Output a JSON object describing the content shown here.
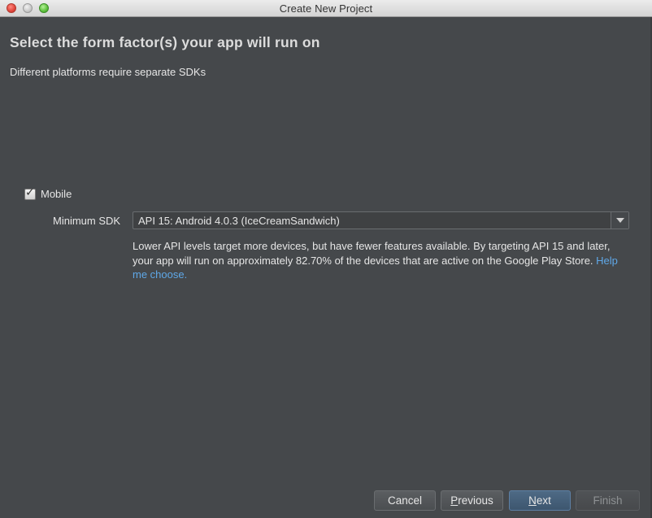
{
  "window": {
    "title": "Create New Project"
  },
  "page": {
    "heading": "Select the form factor(s) your app will run on",
    "subheading": "Different platforms require separate SDKs"
  },
  "mobile": {
    "checkbox_label": "Mobile",
    "checked": true,
    "min_sdk_label": "Minimum SDK",
    "min_sdk_value": "API 15: Android 4.0.3 (IceCreamSandwich)",
    "info_text": "Lower API levels target more devices, but have fewer features available. By targeting API 15 and later, your app will run on approximately 82.70% of the devices that are active on the Google Play Store. ",
    "help_link": "Help me choose."
  },
  "buttons": {
    "cancel": "Cancel",
    "previous_mnemonic": "P",
    "previous_rest": "revious",
    "next_mnemonic": "N",
    "next_rest": "ext",
    "finish": "Finish"
  },
  "colors": {
    "background": "#45484b",
    "link": "#5fa8e8",
    "default_button": "#4e6a85"
  },
  "icons": {
    "close": "traffic-close",
    "minimize": "traffic-minimize",
    "maximize": "traffic-maximize",
    "checkbox": "checkmark",
    "dropdown": "triangle-down"
  }
}
